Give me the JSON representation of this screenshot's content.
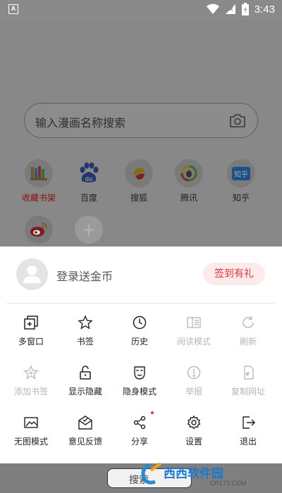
{
  "status_bar": {
    "time": "3:43",
    "app_badge": "A"
  },
  "search": {
    "placeholder": "输入漫画名称搜索"
  },
  "sites": [
    {
      "label": "收藏书架",
      "icon": "bookshelf-icon"
    },
    {
      "label": "百度",
      "icon": "baidu-icon"
    },
    {
      "label": "搜狐",
      "icon": "sohu-icon"
    },
    {
      "label": "腾讯",
      "icon": "tencent-icon"
    },
    {
      "label": "知乎",
      "icon": "zhihu-icon",
      "icon_text": "知乎"
    },
    {
      "label": "",
      "icon": "weibo-icon"
    },
    {
      "label": "",
      "icon": "add-icon",
      "icon_text": "+"
    }
  ],
  "sheet": {
    "login_text": "登录送金币",
    "signin_button": "签到有礼",
    "menu": [
      {
        "label": "多窗口",
        "icon": "multi-window-icon",
        "enabled": true
      },
      {
        "label": "书签",
        "icon": "star-icon",
        "enabled": true
      },
      {
        "label": "历史",
        "icon": "clock-icon",
        "enabled": true
      },
      {
        "label": "阅读模式",
        "icon": "reader-icon",
        "enabled": false
      },
      {
        "label": "刷新",
        "icon": "refresh-icon",
        "enabled": false
      },
      {
        "label": "添加书签",
        "icon": "add-bookmark-icon",
        "enabled": false
      },
      {
        "label": "显示隐藏",
        "icon": "unlock-icon",
        "enabled": true
      },
      {
        "label": "隐身模式",
        "icon": "incognito-mask-icon",
        "enabled": true
      },
      {
        "label": "举报",
        "icon": "report-icon",
        "enabled": false
      },
      {
        "label": "复制网址",
        "icon": "copy-link-icon",
        "enabled": false
      },
      {
        "label": "无图模式",
        "icon": "no-image-icon",
        "enabled": true
      },
      {
        "label": "意见反馈",
        "icon": "feedback-icon",
        "enabled": true
      },
      {
        "label": "分享",
        "icon": "share-icon",
        "enabled": true,
        "badge": true
      },
      {
        "label": "设置",
        "icon": "gear-icon",
        "enabled": true
      },
      {
        "label": "退出",
        "icon": "exit-icon",
        "enabled": true
      }
    ]
  },
  "bottom_bar": {
    "search_label": "搜索"
  },
  "watermark": {
    "text": "西西软件园",
    "url": "CR173.COM"
  },
  "colors": {
    "accent_red": "#d43a3a",
    "signin_bg": "#fdeaea",
    "disabled_gray": "#b7b7b7"
  }
}
